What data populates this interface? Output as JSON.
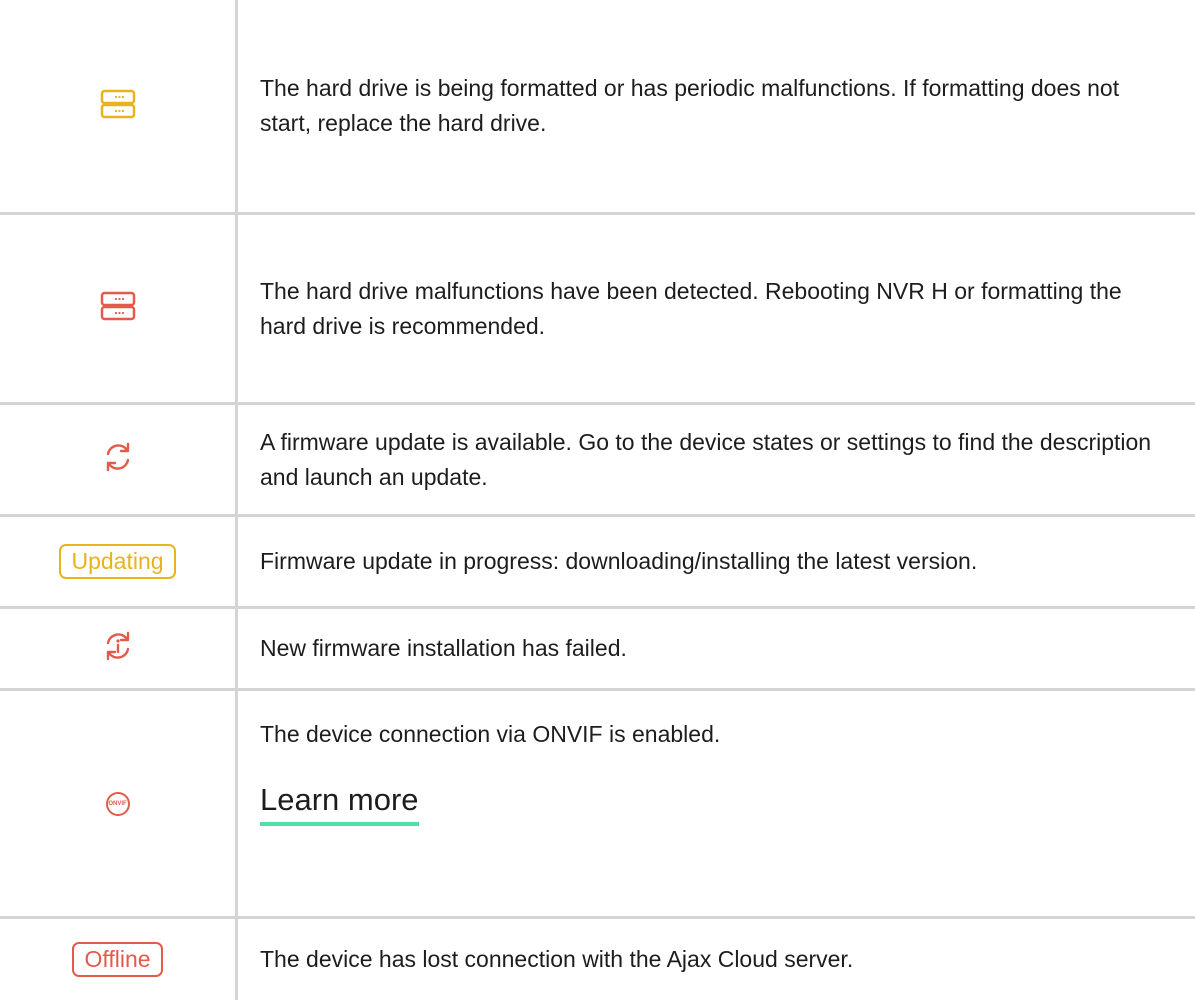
{
  "rows": [
    {
      "icon": "hard-drive-icon",
      "icon_color": "#e8b31c",
      "text": "The hard drive is being formatted or has periodic malfunctions. If formatting does not start, replace the hard drive."
    },
    {
      "icon": "hard-drive-icon",
      "icon_color": "#e25b4b",
      "text": "The hard drive malfunctions have been detected. Rebooting NVR H or formatting the hard drive is recommended."
    },
    {
      "icon": "firmware-update-icon",
      "icon_color": "#e25b4b",
      "text": "A firmware update is available. Go to the device states or settings to find the description and launch an update."
    },
    {
      "badge": "Updating",
      "badge_color": "#e8b31c",
      "text": "Firmware update in progress: downloading/installing the latest version."
    },
    {
      "icon": "firmware-failed-icon",
      "icon_color": "#e25b4b",
      "text": "New firmware installation has failed."
    },
    {
      "icon": "onvif-icon",
      "icon_label": "ONVIF",
      "icon_color": "#e25b4b",
      "text": "The device connection via ONVIF is enabled.",
      "link": "Learn more",
      "link_underline_color": "#4fe0a8"
    },
    {
      "badge": "Offline",
      "badge_color": "#e25b4b",
      "text": "The device has lost connection with the Ajax Cloud server."
    }
  ]
}
